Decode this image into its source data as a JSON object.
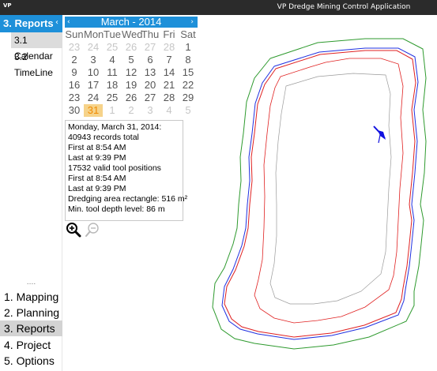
{
  "window": {
    "icon": "VP",
    "title": "VP Dredge Mining Control Application"
  },
  "sidebar": {
    "header": "3. Reports",
    "header_arrow": "‹",
    "sub_items": [
      {
        "label": "3.1 Calendar",
        "selected": true
      },
      {
        "label": "3.2 TimeLine",
        "selected": false
      }
    ],
    "grip": "....",
    "nav_items": [
      {
        "label": "1. Mapping",
        "selected": false
      },
      {
        "label": "2. Planning",
        "selected": false
      },
      {
        "label": "3. Reports",
        "selected": true
      },
      {
        "label": "4. Project",
        "selected": false
      },
      {
        "label": "5. Options",
        "selected": false
      }
    ]
  },
  "calendar": {
    "prev": "‹",
    "next": "›",
    "month_label": "March - 2014",
    "weekdays": [
      "Sun",
      "Mon",
      "Tue",
      "Wed",
      "Thu",
      "Fri",
      "Sat"
    ],
    "weeks": [
      [
        "23",
        "24",
        "25",
        "26",
        "27",
        "28",
        "1"
      ],
      [
        "2",
        "3",
        "4",
        "5",
        "6",
        "7",
        "8"
      ],
      [
        "9",
        "10",
        "11",
        "12",
        "13",
        "14",
        "15"
      ],
      [
        "16",
        "17",
        "18",
        "19",
        "20",
        "21",
        "22"
      ],
      [
        "23",
        "24",
        "25",
        "26",
        "27",
        "28",
        "29"
      ],
      [
        "30",
        "31",
        "1",
        "2",
        "3",
        "4",
        "5"
      ]
    ],
    "selected_day": "31"
  },
  "info": {
    "lines": [
      "Monday, March 31, 2014:",
      "40943 records total",
      "First at 8:54 AM",
      "Last at 9:39 PM",
      "17532 valid tool positions",
      "First at 8:54 AM",
      "Last at 9:39 PM",
      "Dredging area rectangle: 516 m²",
      "Min. tool depth level: 86 m"
    ]
  },
  "zoom": {
    "in_icon": "zoom-in-icon",
    "out_icon": "zoom-out-icon"
  },
  "colors": {
    "accent": "#1e90d9",
    "today": "#f6d38a",
    "outer_boundary": "#2e9a2e",
    "track_red": "#e02020",
    "track_blue": "#2030e0",
    "inner_boundary": "#9a9a9a",
    "dredge": "#1010e0"
  }
}
